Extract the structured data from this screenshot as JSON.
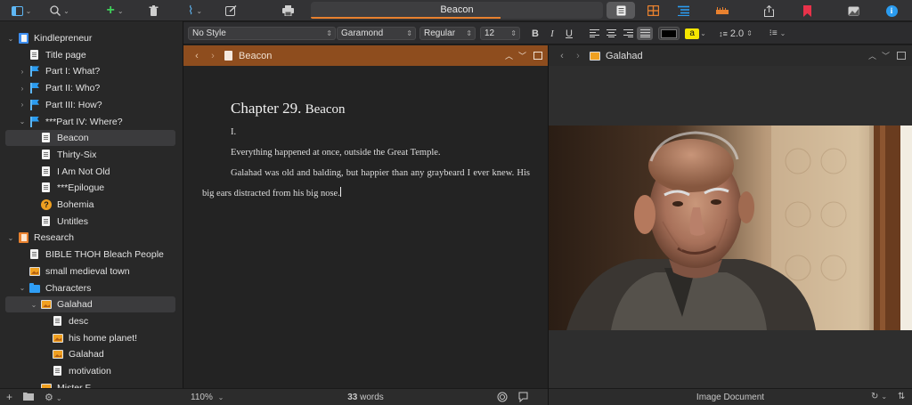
{
  "toolbar": {
    "document_title": "Beacon",
    "progress_fraction": 0.65
  },
  "format_bar": {
    "paragraph_style": "No Style",
    "font_family": "Garamond",
    "font_weight": "Regular",
    "font_size": "12",
    "bold": "B",
    "italic": "I",
    "underline": "U",
    "highlight_label": "a",
    "line_spacing": "2.0",
    "text_color": "#000000",
    "highlight_color": "#f5e600"
  },
  "binder": {
    "items": [
      {
        "label": "Kindlepreneur",
        "icon": "book-icon",
        "indent": 0,
        "disclosure": "open"
      },
      {
        "label": "Title page",
        "icon": "document-icon",
        "indent": 1,
        "disclosure": "none"
      },
      {
        "label": "Part I: What?",
        "icon": "flag-icon",
        "indent": 1,
        "disclosure": "closed"
      },
      {
        "label": "Part II: Who?",
        "icon": "flag-icon",
        "indent": 1,
        "disclosure": "closed"
      },
      {
        "label": "Part III: How?",
        "icon": "flag-icon",
        "indent": 1,
        "disclosure": "closed"
      },
      {
        "label": "***Part IV: Where?",
        "icon": "flag-icon",
        "indent": 1,
        "disclosure": "open"
      },
      {
        "label": "Beacon",
        "icon": "document-icon",
        "indent": 2,
        "disclosure": "none",
        "selected": true
      },
      {
        "label": "Thirty-Six",
        "icon": "document-icon",
        "indent": 2,
        "disclosure": "none"
      },
      {
        "label": "I Am Not Old",
        "icon": "document-icon",
        "indent": 2,
        "disclosure": "none"
      },
      {
        "label": "***Epilogue",
        "icon": "document-icon",
        "indent": 2,
        "disclosure": "none"
      },
      {
        "label": "Bohemia",
        "icon": "question-icon",
        "indent": 2,
        "disclosure": "none"
      },
      {
        "label": "Untitles",
        "icon": "document-icon",
        "indent": 2,
        "disclosure": "none"
      },
      {
        "label": "Research",
        "icon": "research-icon",
        "indent": 0,
        "disclosure": "open"
      },
      {
        "label": "BIBLE THOH Bleach People",
        "icon": "document-icon",
        "indent": 1,
        "disclosure": "none"
      },
      {
        "label": "small medieval town",
        "icon": "image-icon",
        "indent": 1,
        "disclosure": "none"
      },
      {
        "label": "Characters",
        "icon": "folder-icon",
        "indent": 1,
        "disclosure": "open"
      },
      {
        "label": "Galahad",
        "icon": "image-icon",
        "indent": 2,
        "disclosure": "open",
        "selected": true
      },
      {
        "label": "desc",
        "icon": "document-icon",
        "indent": 3,
        "disclosure": "none"
      },
      {
        "label": "his home planet!",
        "icon": "image-icon",
        "indent": 3,
        "disclosure": "none"
      },
      {
        "label": "Galahad",
        "icon": "image-icon",
        "indent": 3,
        "disclosure": "none"
      },
      {
        "label": "motivation",
        "icon": "document-icon",
        "indent": 3,
        "disclosure": "none"
      },
      {
        "label": "Mister F",
        "icon": "image-icon",
        "indent": 2,
        "disclosure": "none"
      }
    ]
  },
  "editor": {
    "header_title": "Beacon",
    "chapter_title": "Chapter 29.",
    "chapter_name": "Beacon",
    "section_mark": "I.",
    "paragraph1": "Everything happened at once, outside the Great Temple.",
    "paragraph2_line1": "Galahad was old and balding, but happier than any graybeard I ever knew. His",
    "paragraph2_line2": "big ears distracted from his big nose.",
    "zoom": "110%",
    "word_count": "33",
    "word_label": "words"
  },
  "inspector": {
    "header_title": "Galahad",
    "footer_label": "Image Document"
  },
  "colors": {
    "accent": "#e8812f",
    "editor_header": "#8e4d1e",
    "flag": "#2b9cf0"
  }
}
